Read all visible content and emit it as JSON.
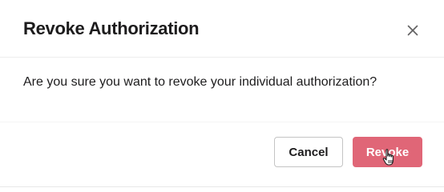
{
  "dialog": {
    "title": "Revoke Authorization",
    "message": "Are you sure you want to revoke your individual authorization?",
    "close_icon": "close-icon",
    "buttons": {
      "cancel_label": "Cancel",
      "revoke_label": "Revoke"
    },
    "colors": {
      "revoke_bg": "#e06677",
      "text": "#1d1c1d"
    }
  },
  "pointer": {
    "icon": "hand-pointer-cursor"
  }
}
